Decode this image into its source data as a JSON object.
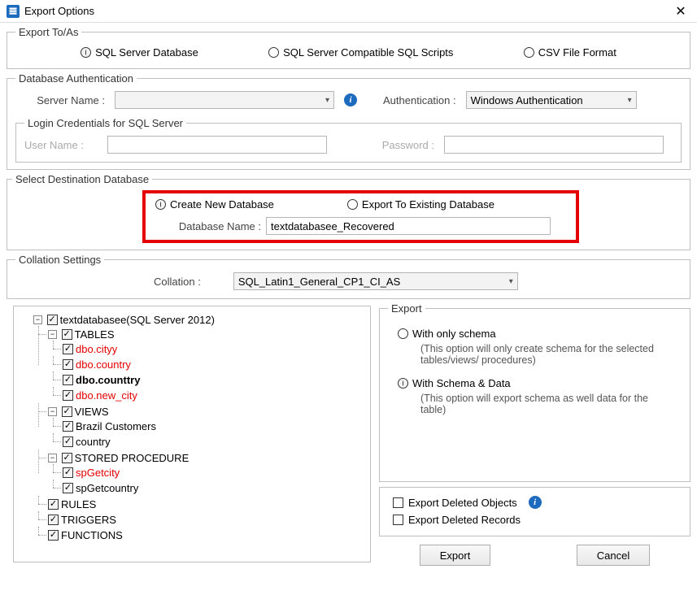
{
  "window": {
    "title": "Export Options"
  },
  "exportToAs": {
    "legend": "Export To/As",
    "opt1": "SQL Server Database",
    "opt2": "SQL Server Compatible SQL Scripts",
    "opt3": "CSV File Format",
    "selected": 0
  },
  "dbAuth": {
    "legend": "Database Authentication",
    "serverNameLabel": "Server Name :",
    "serverName": "",
    "authLabel": "Authentication :",
    "authValue": "Windows Authentication"
  },
  "login": {
    "legend": "Login Credentials for SQL Server",
    "userLabel": "User Name :",
    "userValue": "",
    "passLabel": "Password :",
    "passValue": ""
  },
  "destDb": {
    "legend": "Select Destination Database",
    "optCreate": "Create New Database",
    "optExisting": "Export To Existing Database",
    "selected": 0,
    "dbNameLabel": "Database Name :",
    "dbNameValue": "textdatabasee_Recovered"
  },
  "collation": {
    "legend": "Collation Settings",
    "label": "Collation :",
    "value": "SQL_Latin1_General_CP1_CI_AS"
  },
  "tree": {
    "root": "textdatabasee(SQL Server 2012)",
    "groups": {
      "tables": "TABLES",
      "views": "VIEWS",
      "sp": "STORED PROCEDURE",
      "rules": "RULES",
      "triggers": "TRIGGERS",
      "functions": "FUNCTIONS"
    },
    "tables": [
      "dbo.cityy",
      "dbo.country",
      "dbo.counttry",
      "dbo.new_city"
    ],
    "views": [
      "Brazil Customers",
      "country"
    ],
    "sp": [
      "spGetcity",
      "spGetcountry"
    ]
  },
  "export": {
    "legend": "Export",
    "opt1": "With only schema",
    "desc1": "(This option will only create schema for the  selected tables/views/ procedures)",
    "opt2": "With Schema & Data",
    "desc2": "(This option will export schema as well data for the table)",
    "selected": 1,
    "chkDelObj": "Export Deleted Objects",
    "chkDelRec": "Export Deleted Records",
    "btnExport": "Export",
    "btnCancel": "Cancel"
  }
}
